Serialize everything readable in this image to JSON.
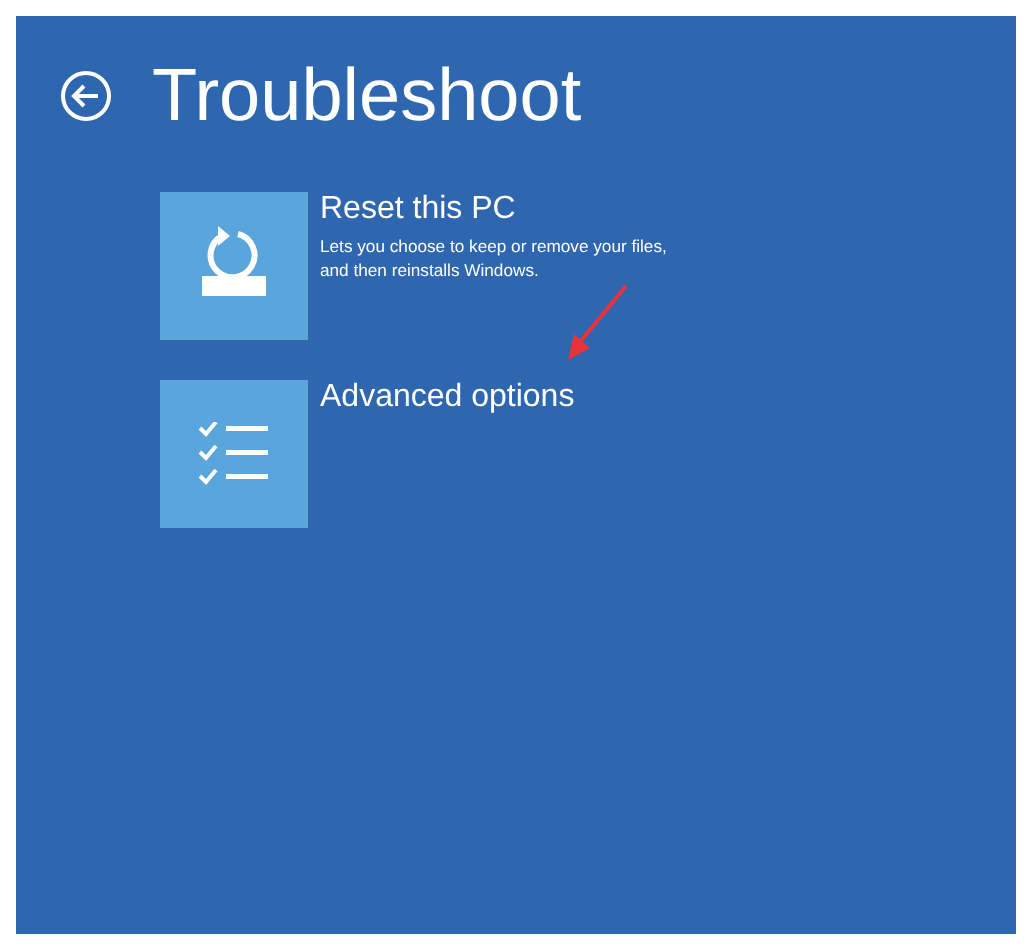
{
  "title": "Troubleshoot",
  "options": [
    {
      "kind": "reset",
      "title": "Reset this PC",
      "description": "Lets you choose to keep or remove your files, and then reinstalls Windows."
    },
    {
      "kind": "advanced",
      "title": "Advanced options"
    }
  ]
}
